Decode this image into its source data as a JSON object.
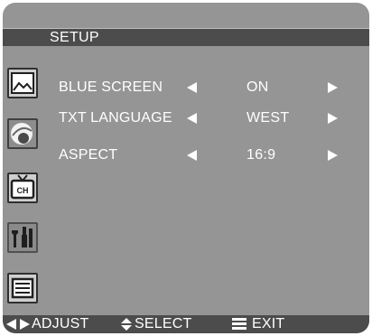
{
  "window": {
    "title": "SETUP"
  },
  "sidebar": {
    "items": [
      {
        "icon": "picture-icon"
      },
      {
        "icon": "sound-icon"
      },
      {
        "icon": "tv-channel-icon"
      },
      {
        "icon": "setup-tools-icon"
      },
      {
        "icon": "menu-list-icon"
      }
    ]
  },
  "settings": [
    {
      "label": "BLUE SCREEN",
      "value": "ON"
    },
    {
      "label": "TXT LANGUAGE",
      "value": "WEST"
    },
    {
      "label": "ASPECT",
      "value": "16:9"
    }
  ],
  "footer": {
    "adjust_label": "ADJUST",
    "select_label": "SELECT",
    "exit_label": "EXIT"
  },
  "colors": {
    "panel": "#959595",
    "bar": "#4c4c4c",
    "text": "#ffffff"
  }
}
